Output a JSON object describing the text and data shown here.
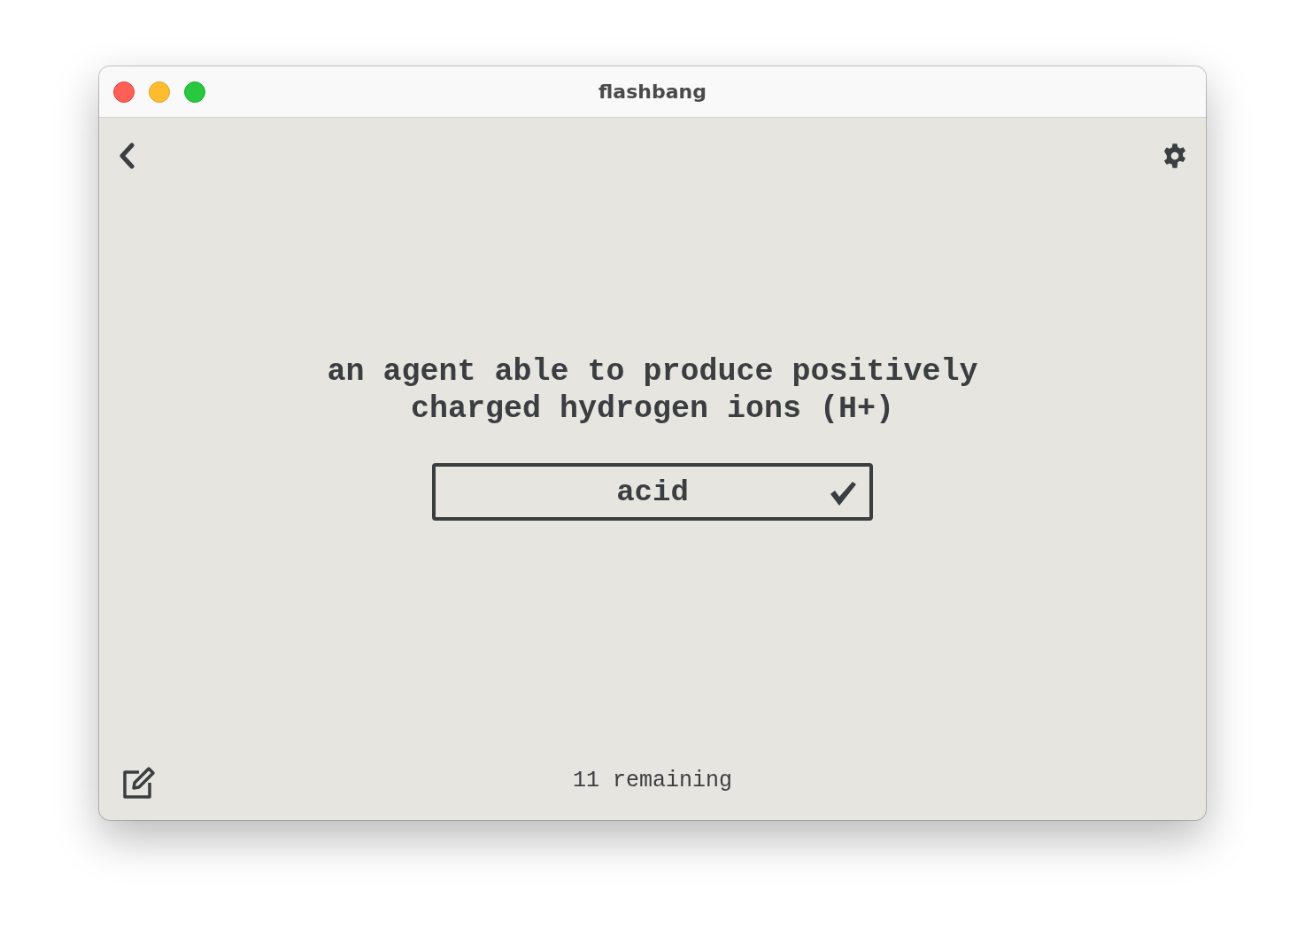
{
  "window": {
    "title": "flashbang"
  },
  "card": {
    "prompt": "an agent able to produce positively charged hydrogen ions (H+)",
    "answer": {
      "value": "acid",
      "correct": true
    }
  },
  "status": "11 remaining"
}
